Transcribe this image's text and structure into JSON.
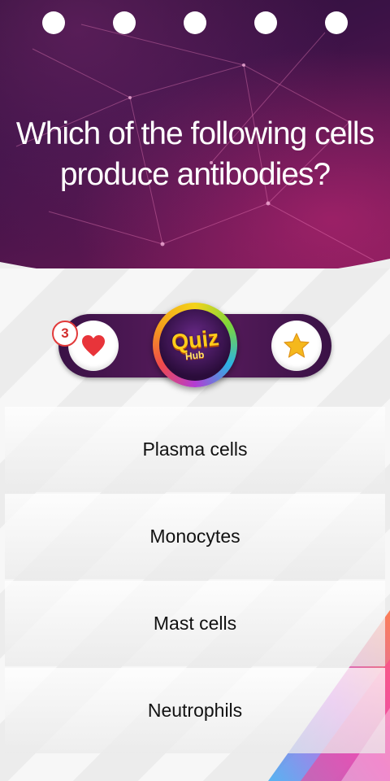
{
  "progress": {
    "total_dots": 5
  },
  "question": {
    "line1": "Which of the following cells",
    "line2": "produce antibodies?"
  },
  "status_bar": {
    "lives_count": "3",
    "logo_text": "Quiz",
    "logo_subtext": "Hub"
  },
  "answers": [
    {
      "label": "Plasma cells"
    },
    {
      "label": "Monocytes"
    },
    {
      "label": "Mast cells"
    },
    {
      "label": "Neutrophils"
    }
  ],
  "colors": {
    "header_bg": "#3b1246",
    "heart": "#e8343a",
    "star": "#f5b81c",
    "badge_border": "#e23a3a"
  }
}
